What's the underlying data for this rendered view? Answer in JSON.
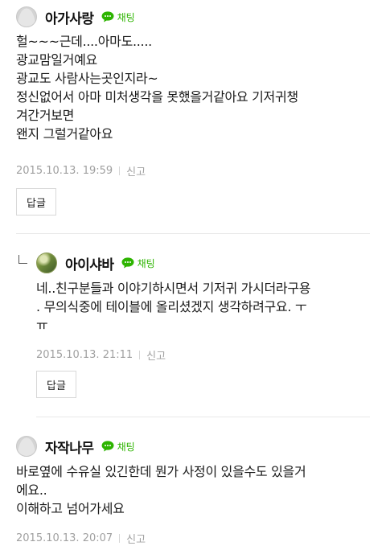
{
  "comments": [
    {
      "nickname": "아가사랑",
      "chat_label": "채팅",
      "lines": [
        "헐~~~근데....아마도.....",
        "광교맘일거예요",
        "광교도 사람사는곳인지라~",
        "정신없어서 아마 미처생각을 못했을거같아요 기저귀챙",
        "겨간거보면",
        "왠지 그럴거같아요"
      ],
      "timestamp": "2015.10.13. 19:59",
      "report_label": "신고",
      "reply_button": "답글"
    },
    {
      "nickname": "아이샤바",
      "chat_label": "채팅",
      "lines": [
        "네..친구분들과 이야기하시면서 기저귀 가시더라구용",
        ". 무의식중에 테이블에 올리셨겠지 생각하려구요. ㅜ",
        "ㅠ"
      ],
      "timestamp": "2015.10.13. 21:11",
      "report_label": "신고",
      "reply_button": "답글"
    },
    {
      "nickname": "자작나무",
      "chat_label": "채팅",
      "lines": [
        "바로옆에 수유실 있긴한데 뭔가 사정이 있을수도 있을거",
        "에요..",
        "이해하고 넘어가세요"
      ],
      "timestamp": "2015.10.13. 20:07",
      "report_label": "신고"
    }
  ],
  "colors": {
    "chat_green": "#2db400",
    "meta_gray": "#a0a0a0",
    "divider": "#e8e8e8"
  },
  "icons": {
    "avatar_default": "default-profile-icon",
    "avatar_photo": "profile-photo",
    "chat": "chat-bubble-icon",
    "reply_indicator": "reply-arrow-icon"
  }
}
